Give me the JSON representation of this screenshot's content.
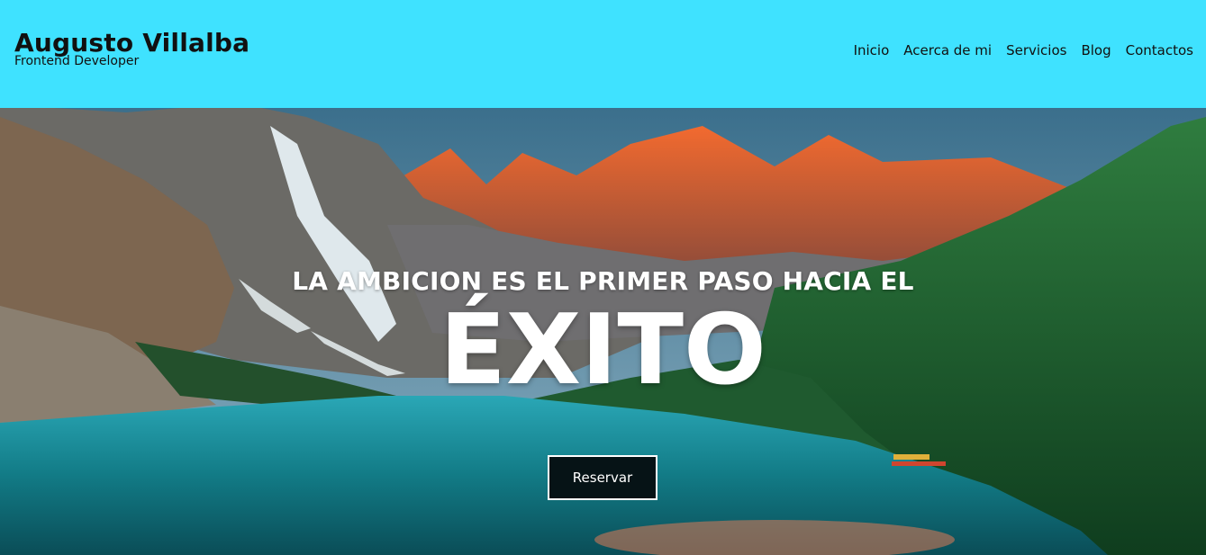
{
  "header": {
    "name": "Augusto Villalba",
    "role": "Frontend Developer",
    "nav": [
      "Inicio",
      "Acerca de mi",
      "Servicios",
      "Blog",
      "Contactos"
    ]
  },
  "hero": {
    "tagline": "LA AMBICION ES EL PRIMER PASO HACIA EL",
    "headline": "ÉXITO",
    "button_label": "Reservar"
  },
  "colors": {
    "header_bg": "#3fe2ff",
    "button_bg": "#061316"
  }
}
